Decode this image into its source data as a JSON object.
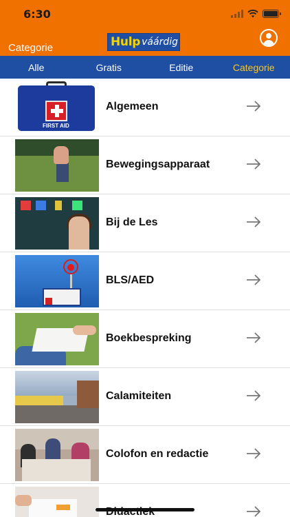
{
  "status_bar": {
    "time": "6:30"
  },
  "header": {
    "left_label": "Categorie",
    "logo_part1": "Hulp",
    "logo_part2": "váárdig"
  },
  "tabs": [
    {
      "label": "Alle",
      "active": false
    },
    {
      "label": "Gratis",
      "active": false
    },
    {
      "label": "Editie",
      "active": false
    },
    {
      "label": "Categorie",
      "active": true
    }
  ],
  "thumbnail_texts": {
    "first_aid": "FIRST AID"
  },
  "categories": [
    {
      "label": "Algemeen",
      "icon": "arrow-right-icon"
    },
    {
      "label": "Bewegingsapparaat",
      "icon": "arrow-right-icon"
    },
    {
      "label": "Bij de Les",
      "icon": "arrow-right-icon"
    },
    {
      "label": "BLS/AED",
      "icon": "arrow-right-icon"
    },
    {
      "label": "Boekbespreking",
      "icon": "arrow-right-icon"
    },
    {
      "label": "Calamiteiten",
      "icon": "arrow-right-icon"
    },
    {
      "label": "Colofon en redactie",
      "icon": "arrow-right-icon"
    },
    {
      "label": "Didactiek",
      "icon": "arrow-right-icon"
    }
  ],
  "colors": {
    "header_orange": "#f07000",
    "tab_blue": "#1e4fa2",
    "active_tab": "#f6c52b"
  }
}
